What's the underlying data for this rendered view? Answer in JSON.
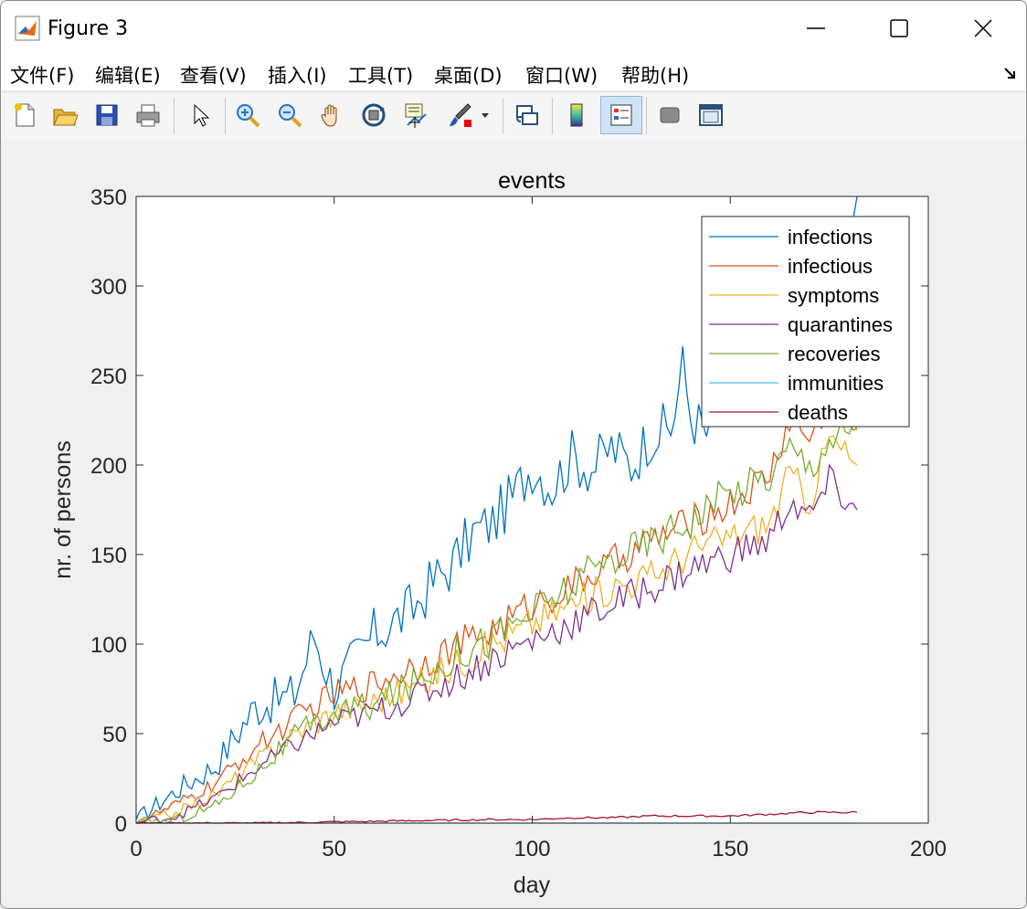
{
  "window": {
    "title": "Figure 3"
  },
  "menu": {
    "items": [
      "文件(F)",
      "编辑(E)",
      "查看(V)",
      "插入(I)",
      "工具(T)",
      "桌面(D)",
      "窗口(W)",
      "帮助(H)"
    ]
  },
  "toolbar": {
    "buttons": [
      "new-figure-icon",
      "open-file-icon",
      "save-icon",
      "print-icon",
      "pointer-icon",
      "zoom-in-icon",
      "zoom-out-icon",
      "pan-hand-icon",
      "rotate-3d-icon",
      "data-cursor-icon",
      "brush-icon",
      "link-plot-icon",
      "colorbar-icon",
      "legend-icon",
      "hide-plot-tools-icon",
      "show-plot-tools-icon"
    ]
  },
  "colors": {
    "infections": "#0072BD",
    "infectious": "#D95319",
    "symptoms": "#EDB120",
    "quarantines": "#7E2F8E",
    "recoveries": "#77AC30",
    "immunities": "#4DBEEE",
    "deaths": "#A2142F"
  },
  "chart_data": {
    "type": "line",
    "title": "events",
    "xlabel": "day",
    "ylabel": "nr. of persons",
    "xlim": [
      0,
      200
    ],
    "ylim": [
      0,
      350
    ],
    "xticks": [
      0,
      50,
      100,
      150,
      200
    ],
    "yticks": [
      0,
      50,
      100,
      150,
      200,
      250,
      300,
      350
    ],
    "legend_position": "top-right",
    "series": [
      {
        "name": "infections",
        "x": [
          0,
          10,
          20,
          30,
          40,
          45,
          50,
          60,
          70,
          75,
          80,
          85,
          90,
          95,
          100,
          105,
          110,
          115,
          120,
          125,
          130,
          135,
          138,
          140,
          145,
          150,
          155,
          160,
          165,
          170,
          175,
          182
        ],
        "values": [
          2,
          18,
          32,
          65,
          72,
          105,
          75,
          105,
          120,
          135,
          145,
          162,
          168,
          182,
          200,
          188,
          205,
          198,
          210,
          200,
          218,
          220,
          255,
          228,
          215,
          262,
          232,
          278,
          248,
          286,
          310,
          350
        ]
      },
      {
        "name": "infectious",
        "x": [
          0,
          10,
          20,
          30,
          40,
          50,
          60,
          70,
          80,
          90,
          100,
          110,
          120,
          130,
          140,
          150,
          160,
          165,
          170,
          175,
          182
        ],
        "values": [
          0,
          10,
          22,
          42,
          58,
          72,
          78,
          88,
          98,
          108,
          122,
          132,
          145,
          158,
          168,
          178,
          195,
          225,
          215,
          235,
          220
        ]
      },
      {
        "name": "symptoms",
        "x": [
          0,
          10,
          20,
          30,
          40,
          50,
          60,
          70,
          80,
          90,
          100,
          110,
          120,
          130,
          140,
          150,
          160,
          165,
          170,
          175,
          182
        ],
        "values": [
          0,
          6,
          16,
          34,
          50,
          62,
          68,
          76,
          88,
          100,
          112,
          122,
          132,
          138,
          152,
          160,
          168,
          195,
          180,
          215,
          200
        ]
      },
      {
        "name": "quarantines",
        "x": [
          0,
          10,
          20,
          30,
          40,
          50,
          60,
          70,
          80,
          90,
          100,
          110,
          120,
          130,
          140,
          150,
          160,
          165,
          170,
          175,
          182
        ],
        "values": [
          0,
          4,
          14,
          30,
          44,
          56,
          62,
          70,
          80,
          92,
          102,
          112,
          122,
          132,
          142,
          150,
          158,
          180,
          170,
          190,
          175
        ]
      },
      {
        "name": "recoveries",
        "x": [
          0,
          10,
          20,
          30,
          40,
          50,
          60,
          70,
          80,
          90,
          100,
          110,
          120,
          130,
          140,
          150,
          160,
          165,
          170,
          175,
          182
        ],
        "values": [
          0,
          2,
          10,
          28,
          48,
          62,
          66,
          78,
          94,
          104,
          118,
          132,
          148,
          158,
          170,
          185,
          195,
          210,
          200,
          215,
          220
        ]
      },
      {
        "name": "immunities",
        "x": [
          0,
          50,
          100,
          150,
          182
        ],
        "values": [
          0,
          0,
          0,
          0,
          0
        ]
      },
      {
        "name": "deaths",
        "x": [
          0,
          30,
          60,
          90,
          100,
          110,
          120,
          130,
          140,
          150,
          160,
          170,
          175,
          182
        ],
        "values": [
          0,
          0,
          1,
          2,
          2,
          3,
          3,
          4,
          4,
          4,
          5,
          6,
          6,
          6
        ]
      }
    ]
  }
}
